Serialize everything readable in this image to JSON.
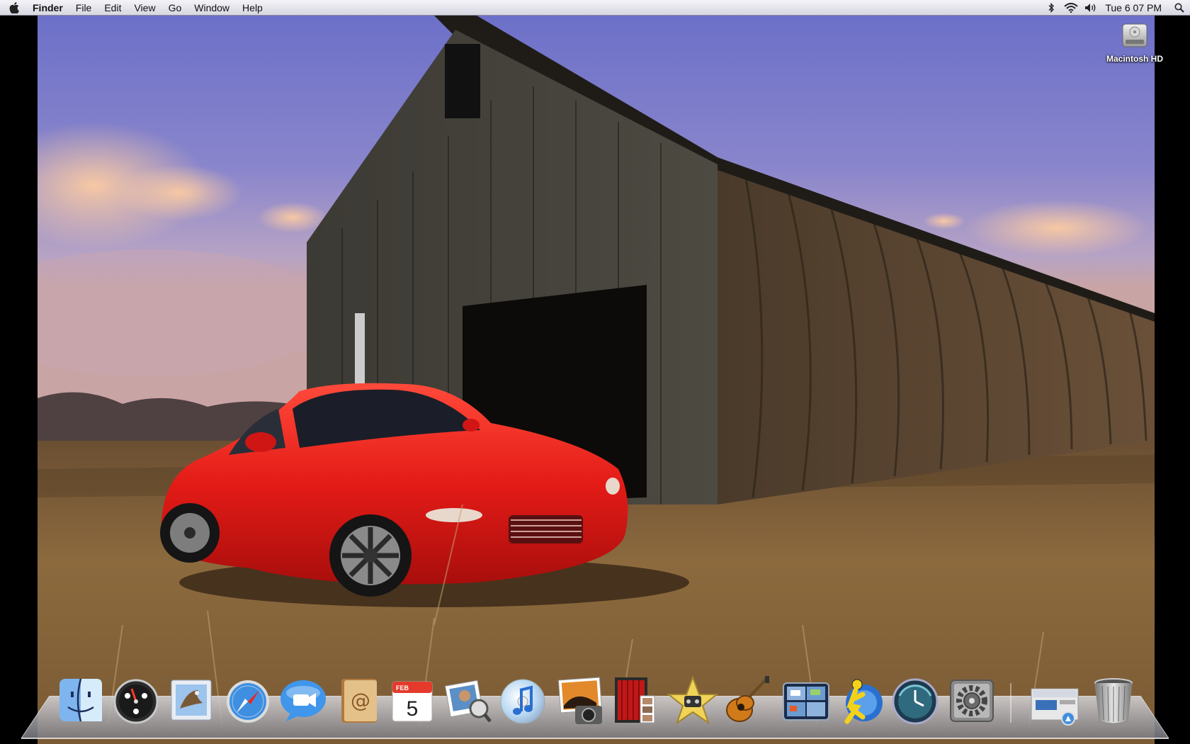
{
  "menubar": {
    "apple_icon": "apple-logo-icon",
    "app_name": "Finder",
    "menus": [
      "File",
      "Edit",
      "View",
      "Go",
      "Window",
      "Help"
    ],
    "status_icons": [
      "bluetooth-icon",
      "wifi-icon",
      "volume-icon"
    ],
    "clock": "Tue 6 07 PM",
    "spotlight_icon": "spotlight-search-icon"
  },
  "desktop": {
    "wallpaper": "red sports car in front of weathered barn in a dry field at dusk",
    "icons": [
      {
        "label": "Macintosh HD",
        "icon": "hard-drive-icon"
      }
    ]
  },
  "dock": {
    "apps": [
      {
        "icon": "finder-icon"
      },
      {
        "icon": "dashboard-icon"
      },
      {
        "icon": "mail-icon"
      },
      {
        "icon": "safari-icon"
      },
      {
        "icon": "ichat-icon"
      },
      {
        "icon": "address-book-icon"
      },
      {
        "icon": "ical-icon",
        "month": "FEB",
        "day": "5"
      },
      {
        "icon": "preview-icon"
      },
      {
        "icon": "itunes-icon"
      },
      {
        "icon": "iphoto-icon"
      },
      {
        "icon": "photo-booth-icon"
      },
      {
        "icon": "imovie-icon"
      },
      {
        "icon": "garageband-icon"
      },
      {
        "icon": "spaces-icon"
      },
      {
        "icon": "aim-icon"
      },
      {
        "icon": "time-machine-icon"
      },
      {
        "icon": "system-preferences-icon"
      }
    ],
    "stacks": [
      {
        "icon": "downloads-stack-icon"
      },
      {
        "icon": "trash-icon"
      }
    ]
  },
  "colors": {
    "menubar": "#e4e4ec",
    "sky_top": "#6e6fc9",
    "car_red": "#e41b17",
    "field": "#8c6a3e"
  }
}
